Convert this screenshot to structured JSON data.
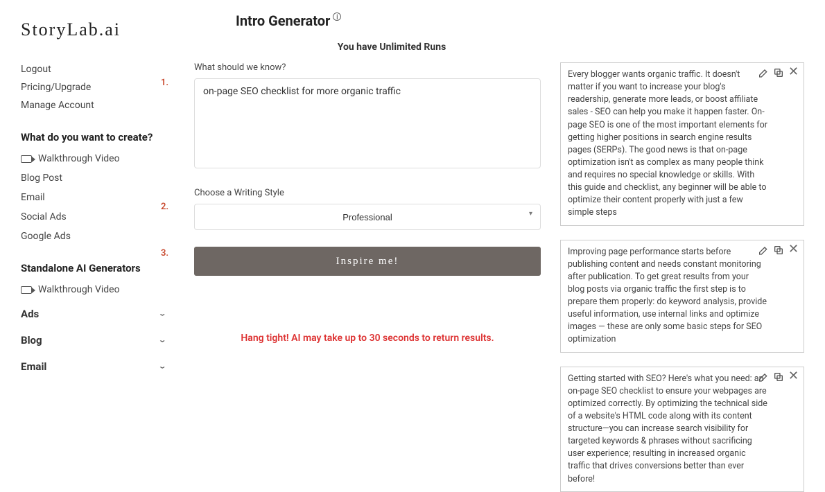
{
  "brand": "StoryLab.ai",
  "sidebar": {
    "top_links": [
      "Logout",
      "Pricing/Upgrade",
      "Manage Account"
    ],
    "create_heading": "What do you want to create?",
    "create_items": [
      {
        "label": "Walkthrough Video",
        "icon": "video"
      },
      {
        "label": "Blog Post"
      },
      {
        "label": "Email"
      },
      {
        "label": "Social Ads"
      },
      {
        "label": "Google Ads"
      }
    ],
    "standalone_heading": "Standalone AI Generators",
    "standalone_items": [
      {
        "label": "Walkthrough Video",
        "icon": "video"
      }
    ],
    "collapsibles": [
      "Ads",
      "Blog",
      "Email"
    ]
  },
  "page_title": "Intro Generator",
  "runs_text": "You have Unlimited Runs",
  "form": {
    "step1_num": "1.",
    "step1_label": "What should we know?",
    "step1_value": "on-page SEO checklist for more organic traffic",
    "step2_num": "2.",
    "step2_label": "Choose a Writing Style",
    "step2_selected": "Professional",
    "step3_num": "3.",
    "button_label": "Inspire me!"
  },
  "status_text": "Hang tight! AI may take up to 30 seconds to return results.",
  "results": [
    "Every blogger wants organic traffic. It doesn't matter if you want to increase your blog's readership, generate more leads, or boost affiliate sales - SEO can help you make it happen faster. On-page SEO is one of the most important elements for getting higher positions in search engine results pages (SERPs). The good news is that on-page optimization isn't as complex as many people think and requires no special knowledge or skills. With this guide and checklist, any beginner will be able to optimize their content properly with just a few simple steps",
    "Improving page performance starts before publishing content and needs constant monitoring after publication. To get great results from your blog posts via organic traffic the first step is to prepare them properly: do keyword analysis, provide useful information, use internal links and optimize images — these are only some basic steps for SEO optimization",
    "Getting started with SEO? Here's what you need: an on-page SEO checklist to ensure your webpages are optimized correctly. By optimizing the technical side of a website's HTML code along with its content structure—you can increase search visibility for targeted keywords & phrases without sacrificing user experience; resulting in increased organic traffic that drives conversions better than ever before!"
  ]
}
